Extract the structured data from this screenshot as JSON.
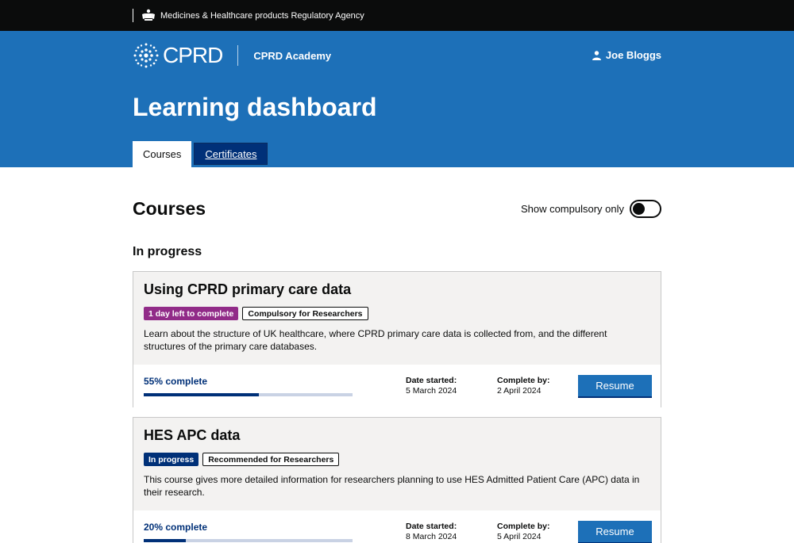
{
  "agency": {
    "name": "Medicines & Healthcare products Regulatory Agency"
  },
  "header": {
    "brand": "CPRD",
    "service": "CPRD Academy",
    "user": "Joe Bloggs",
    "page_title": "Learning dashboard",
    "tabs": [
      {
        "label": "Courses",
        "active": true
      },
      {
        "label": "Certificates",
        "active": false
      }
    ]
  },
  "main": {
    "section_title": "Courses",
    "toggle_label": "Show compulsory only",
    "toggle_on": false,
    "subheading": "In progress",
    "courses": [
      {
        "title": "Using CPRD primary care data",
        "status_tag": "1 day left to complete",
        "audience_tag": "Compulsory for Researchers",
        "description": "Learn about the structure of UK healthcare, where CPRD primary care data is collected from, and the different structures of the primary care databases.",
        "progress_label": "55% complete",
        "progress": 55,
        "date_started_label": "Date started:",
        "date_started": "5 March 2024",
        "complete_by_label": "Complete by:",
        "complete_by": "2 April 2024",
        "button": "Resume"
      },
      {
        "title": "HES APC data",
        "status_tag": "In progress",
        "audience_tag": "Recommended for Researchers",
        "description": "This course gives more detailed information for researchers planning to use HES Admitted Patient Care (APC) data in their research.",
        "progress_label": "20% complete",
        "progress": 20,
        "date_started_label": "Date started:",
        "date_started": "8 March 2024",
        "complete_by_label": "Complete by:",
        "complete_by": "5 April 2024",
        "button": "Resume"
      }
    ]
  },
  "colors": {
    "header_blue": "#1d70b8",
    "dark_blue": "#003078",
    "purple_tag": "#912b88",
    "card_bg": "#f3f2f1"
  },
  "icons": {
    "crest": "royal-crest-icon",
    "logo": "cprd-dots-logo-icon",
    "user": "user-icon"
  }
}
